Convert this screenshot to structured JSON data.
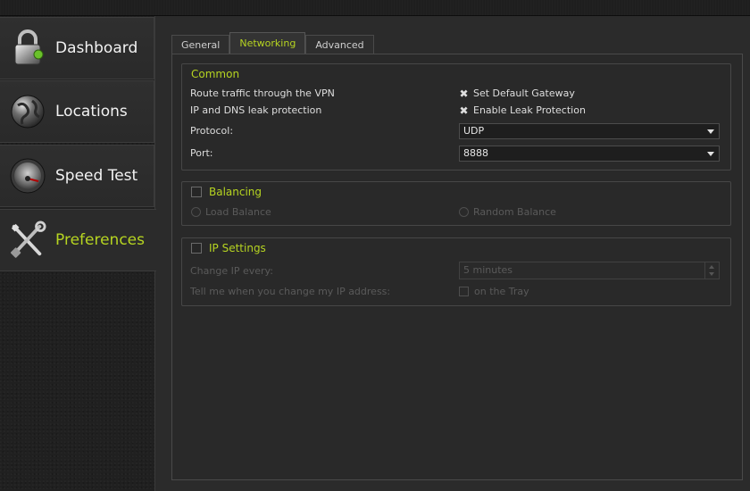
{
  "sidebar": {
    "items": [
      {
        "label": "Dashboard",
        "icon": "lock-icon",
        "active": false
      },
      {
        "label": "Locations",
        "icon": "globe-icon",
        "active": false
      },
      {
        "label": "Speed Test",
        "icon": "speedometer-icon",
        "active": false
      },
      {
        "label": "Preferences",
        "icon": "tools-icon",
        "active": true
      }
    ]
  },
  "tabs": [
    {
      "label": "General",
      "active": false
    },
    {
      "label": "Networking",
      "active": true
    },
    {
      "label": "Advanced",
      "active": false
    }
  ],
  "common": {
    "title": "Common",
    "route_label": "Route traffic through the VPN",
    "leak_label": "IP and DNS leak protection",
    "gateway_option": "Set Default Gateway",
    "gateway_checked": true,
    "leak_option": "Enable Leak Protection",
    "leak_checked": true,
    "protocol_label": "Protocol:",
    "protocol_value": "UDP",
    "port_label": "Port:",
    "port_value": "8888"
  },
  "balancing": {
    "title": "Balancing",
    "checked": false,
    "load_balance": "Load Balance",
    "random_balance": "Random Balance"
  },
  "ip_settings": {
    "title": "IP Settings",
    "checked": false,
    "change_label": "Change IP every:",
    "change_value": "5 minutes",
    "tell_label": "Tell me when you change my IP address:",
    "tray_option": "on the Tray"
  },
  "colors": {
    "accent": "#b6d421",
    "background": "#2b2b2b",
    "text": "#d8d8d8",
    "disabled": "#5a5a5a"
  }
}
